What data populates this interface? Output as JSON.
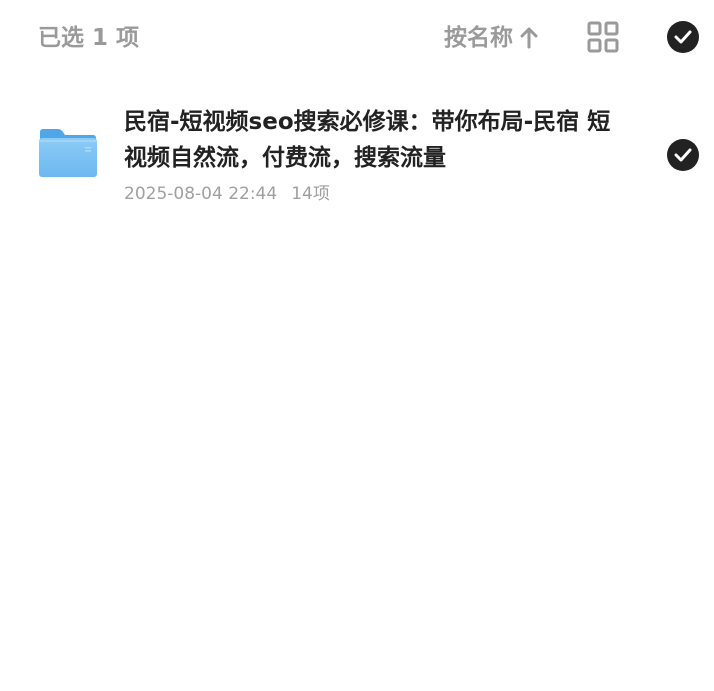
{
  "toolbar": {
    "selected_label": "已选 1 项",
    "sort_label": "按名称",
    "sort_icon": "arrow-up-icon",
    "view_icon": "grid-view-icon",
    "select_all_icon": "check-circle-icon"
  },
  "files": [
    {
      "name": "民宿-短视频seo搜索必修课：带你布局-民宿 短视频自然流，付费流，搜索流量",
      "date": "2025-08-04 22:44",
      "count": "14项",
      "icon": "folder-icon",
      "selected": true
    }
  ],
  "colors": {
    "check_fill": "#222222",
    "folder_blue": "#6cb8f0",
    "muted_text": "#9a9a9a"
  }
}
